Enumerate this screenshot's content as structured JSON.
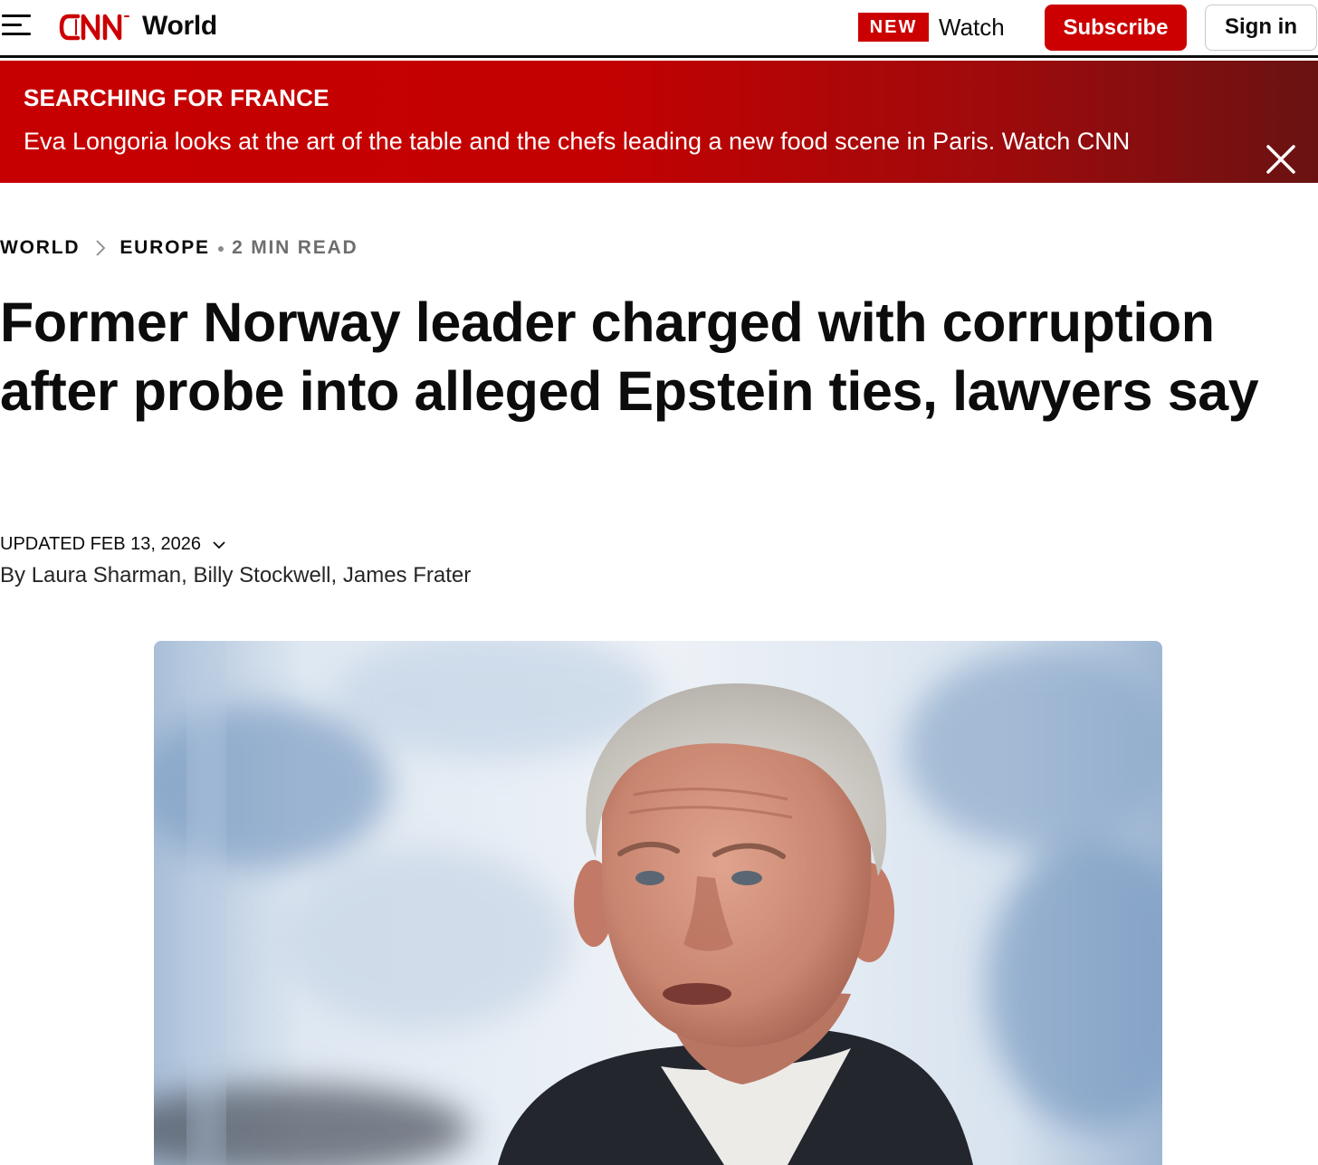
{
  "header": {
    "menu_icon": "hamburger-menu-icon",
    "logo_text": "CNN",
    "section": "World",
    "new_badge": "NEW",
    "watch": "Watch",
    "subscribe": "Subscribe",
    "sign_in": "Sign in"
  },
  "banner": {
    "title": "SEARCHING FOR FRANCE",
    "text": "Eva Longoria looks at the art of the table and the chefs leading a new food scene in Paris. Watch CNN",
    "close_icon": "close-icon"
  },
  "breadcrumb": {
    "items": [
      "WORLD",
      "EUROPE"
    ],
    "read_time": "2 MIN READ"
  },
  "article": {
    "headline": "Former Norway leader charged with corruption after probe into alleged Epstein ties, lawyers say",
    "updated": "UPDATED FEB 13, 2026",
    "byline_prefix": "By",
    "authors": [
      "Laura Sharman",
      "Billy Stockwell",
      "James Frater"
    ]
  },
  "colors": {
    "brand_red": "#cc0000",
    "text": "#0c0c0c"
  }
}
